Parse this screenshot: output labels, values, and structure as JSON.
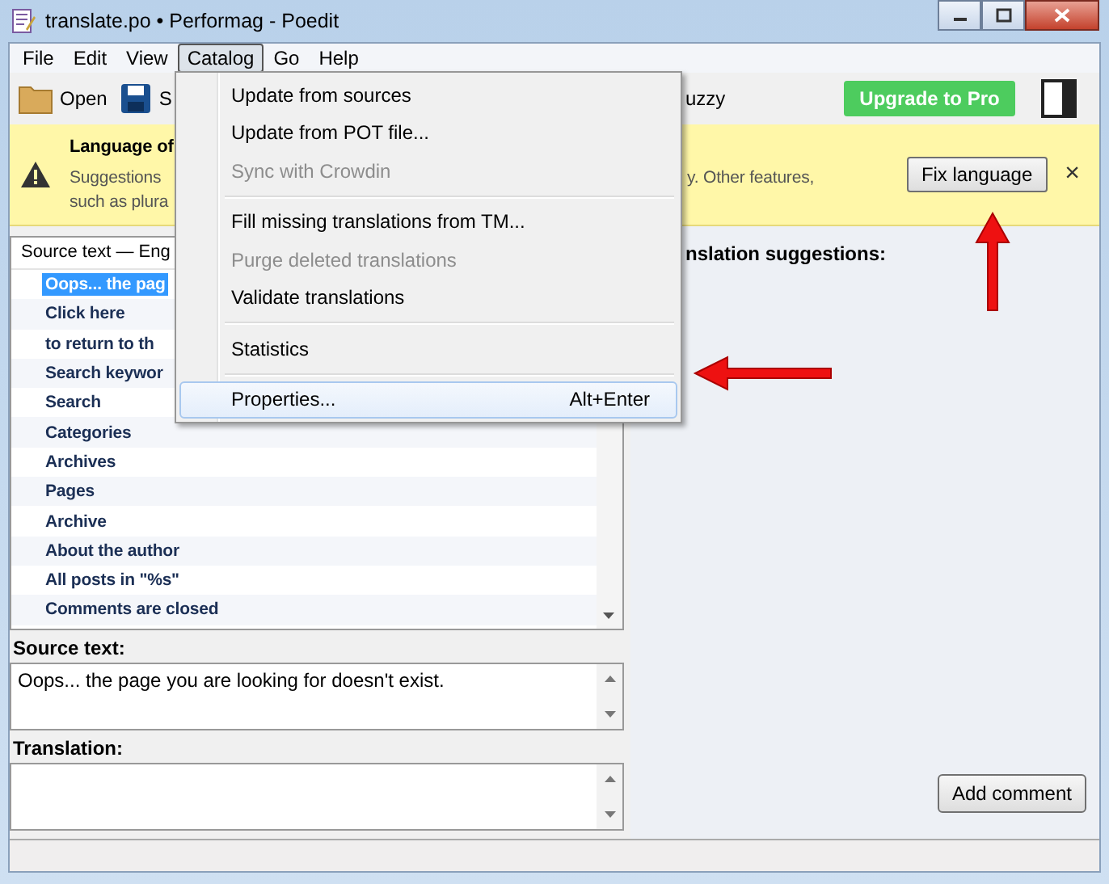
{
  "window": {
    "title": "translate.po • Performag - Poedit"
  },
  "menubar": [
    {
      "label": "File",
      "selected": false
    },
    {
      "label": "Edit",
      "selected": false
    },
    {
      "label": "View",
      "selected": false
    },
    {
      "label": "Catalog",
      "selected": true
    },
    {
      "label": "Go",
      "selected": false
    },
    {
      "label": "Help",
      "selected": false
    }
  ],
  "toolbar": {
    "open": "Open",
    "save": "S",
    "fuzzy": "uzzy",
    "upgrade": "Upgrade to Pro"
  },
  "banner": {
    "title": "Language of",
    "line_1_start": "Suggestions",
    "line_1_end": "y. Other features,",
    "line_2": "such as plura",
    "button": "Fix language",
    "close": "×"
  },
  "catalog_menu": [
    {
      "kind": "item",
      "label": "Update from sources",
      "disabled": false,
      "selected": false
    },
    {
      "kind": "item",
      "label": "Update from POT file...",
      "disabled": false,
      "selected": false
    },
    {
      "kind": "item",
      "label": "Sync with Crowdin",
      "disabled": true,
      "selected": false
    },
    {
      "kind": "separator"
    },
    {
      "kind": "item",
      "label": "Fill missing translations from TM...",
      "disabled": false,
      "selected": false
    },
    {
      "kind": "item",
      "label": "Purge deleted translations",
      "disabled": true,
      "selected": false
    },
    {
      "kind": "item",
      "label": "Validate translations",
      "disabled": false,
      "selected": false
    },
    {
      "kind": "separator"
    },
    {
      "kind": "item",
      "label": "Statistics",
      "disabled": false,
      "selected": false
    },
    {
      "kind": "separator"
    },
    {
      "kind": "item",
      "label": "Properties...",
      "shortcut": "Alt+Enter",
      "disabled": false,
      "selected": true
    }
  ],
  "list": {
    "header": "Source text — Eng",
    "rows": [
      {
        "text": "Oops... the pag",
        "selected": true
      },
      {
        "text": "Click here",
        "selected": false
      },
      {
        "text": "to return to th",
        "selected": false
      },
      {
        "text": "Search keywor",
        "selected": false
      },
      {
        "text": "Search",
        "selected": false
      },
      {
        "text": "Categories",
        "selected": false
      },
      {
        "text": "Archives",
        "selected": false
      },
      {
        "text": "Pages",
        "selected": false
      },
      {
        "text": "Archive",
        "selected": false
      },
      {
        "text": "About the author",
        "selected": false
      },
      {
        "text": "All posts in \"%s\"",
        "selected": false
      },
      {
        "text": "Comments are closed",
        "selected": false
      }
    ]
  },
  "suggestions": {
    "title": "nslation suggestions:"
  },
  "source": {
    "label": "Source text:",
    "value": "Oops... the page you are looking for doesn't exist."
  },
  "translation": {
    "label": "Translation:"
  },
  "add_comment": "Add comment"
}
